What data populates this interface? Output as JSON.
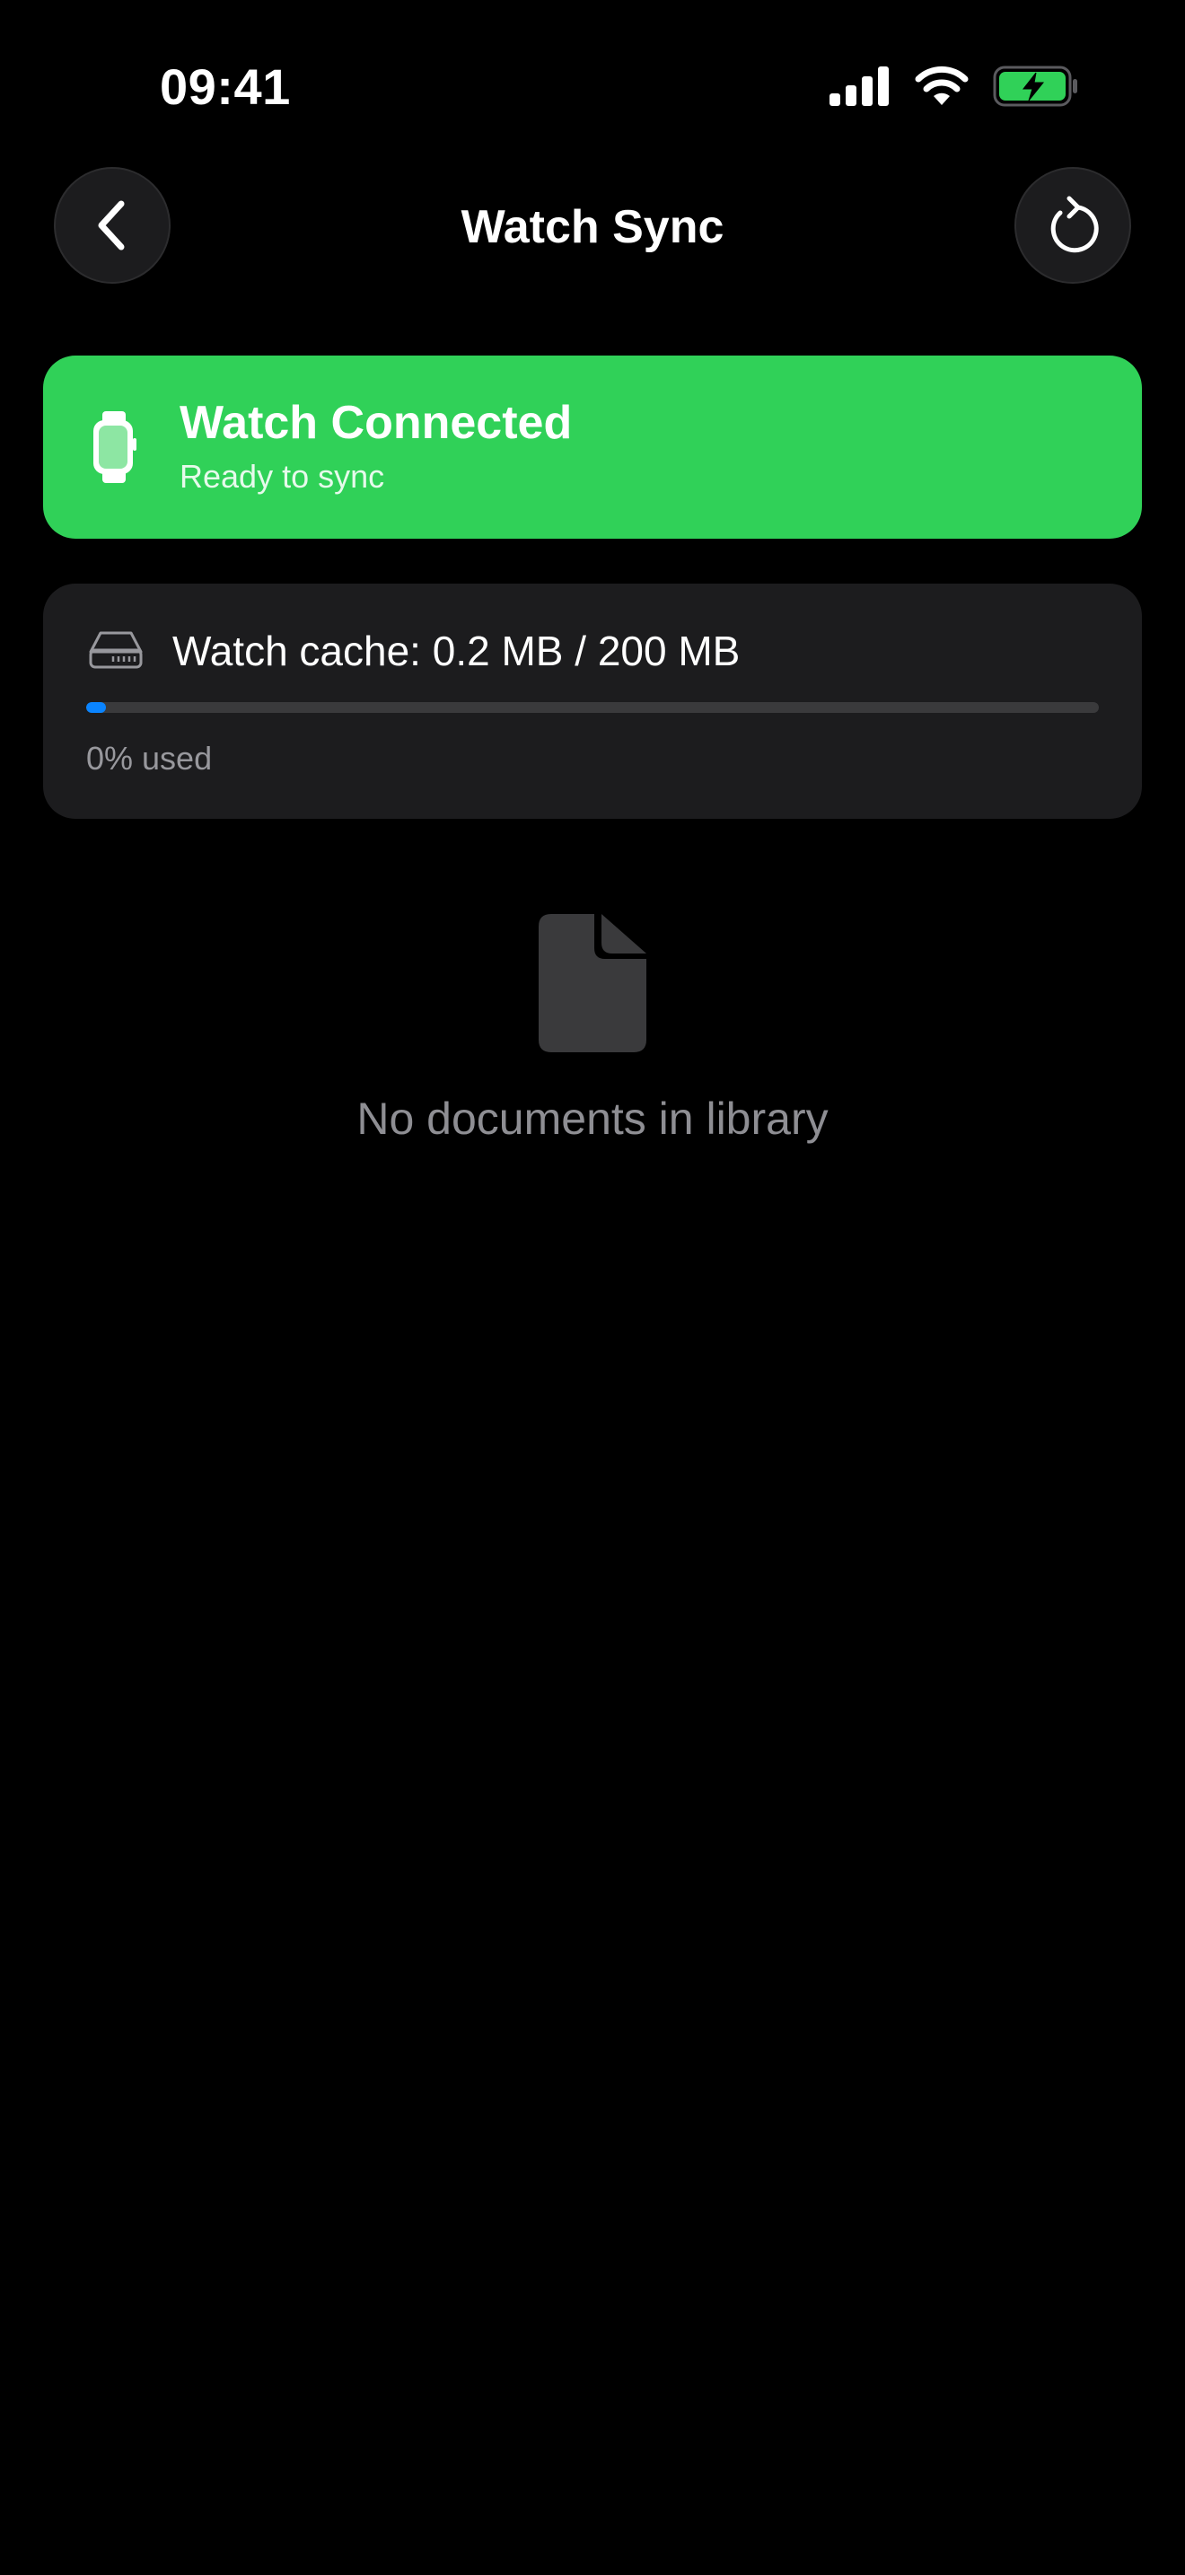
{
  "status_bar": {
    "time": "09:41",
    "icons": [
      "cellular-signal-icon",
      "wifi-icon",
      "battery-charging-icon"
    ],
    "battery_color": "#30d158"
  },
  "nav": {
    "title": "Watch Sync",
    "back_icon": "chevron-left-icon",
    "refresh_icon": "refresh-icon"
  },
  "connection": {
    "title": "Watch Connected",
    "subtitle": "Ready to sync",
    "icon": "watch-icon",
    "color": "#30d158"
  },
  "cache": {
    "label": "Watch cache: 0.2 MB / 200 MB",
    "usage_text": "0% used",
    "used_fraction": 0.001,
    "icon": "internal-drive-icon",
    "bar_color": "#0a84ff"
  },
  "library": {
    "empty_text": "No documents in library",
    "icon": "document-icon"
  }
}
